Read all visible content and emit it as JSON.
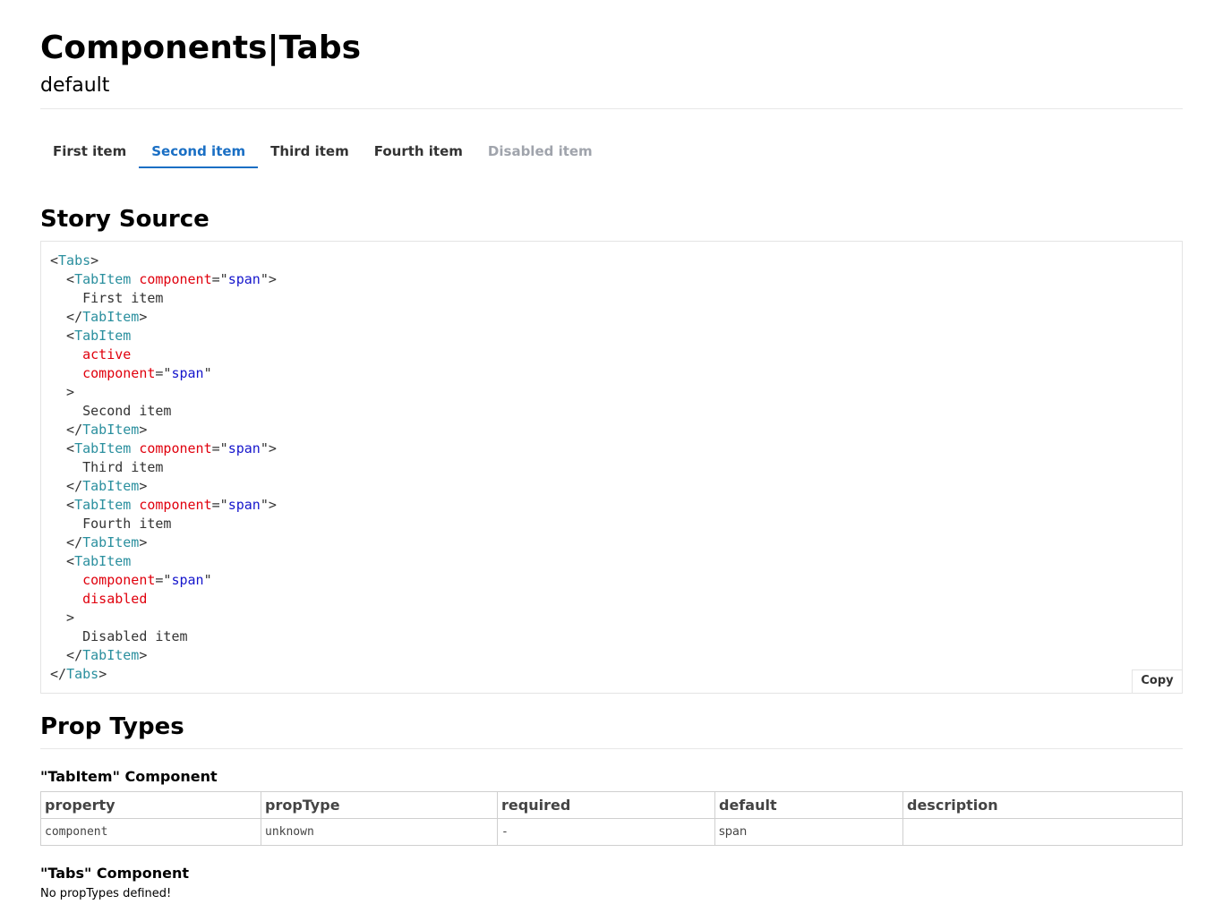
{
  "header": {
    "title": "Components|Tabs",
    "subtitle": "default"
  },
  "tabs": [
    {
      "label": "First item",
      "state": "normal"
    },
    {
      "label": "Second item",
      "state": "active"
    },
    {
      "label": "Third item",
      "state": "normal"
    },
    {
      "label": "Fourth item",
      "state": "normal"
    },
    {
      "label": "Disabled item",
      "state": "disabled"
    }
  ],
  "story_source": {
    "heading": "Story Source",
    "copy_label": "Copy",
    "lines": [
      [
        [
          "p",
          "<"
        ],
        [
          "t",
          "Tabs"
        ],
        [
          "p",
          ">"
        ]
      ],
      [
        [
          "p",
          "  <"
        ],
        [
          "t",
          "TabItem"
        ],
        [
          "p",
          " "
        ],
        [
          "a",
          "component"
        ],
        [
          "p",
          "=\""
        ],
        [
          "v",
          "span"
        ],
        [
          "p",
          "\">"
        ]
      ],
      [
        [
          "p",
          "    First item"
        ]
      ],
      [
        [
          "p",
          "  </"
        ],
        [
          "t",
          "TabItem"
        ],
        [
          "p",
          ">"
        ]
      ],
      [
        [
          "p",
          "  <"
        ],
        [
          "t",
          "TabItem"
        ]
      ],
      [
        [
          "p",
          "    "
        ],
        [
          "a",
          "active"
        ]
      ],
      [
        [
          "p",
          "    "
        ],
        [
          "a",
          "component"
        ],
        [
          "p",
          "=\""
        ],
        [
          "v",
          "span"
        ],
        [
          "p",
          "\""
        ]
      ],
      [
        [
          "p",
          "  >"
        ]
      ],
      [
        [
          "p",
          "    Second item"
        ]
      ],
      [
        [
          "p",
          "  </"
        ],
        [
          "t",
          "TabItem"
        ],
        [
          "p",
          ">"
        ]
      ],
      [
        [
          "p",
          "  <"
        ],
        [
          "t",
          "TabItem"
        ],
        [
          "p",
          " "
        ],
        [
          "a",
          "component"
        ],
        [
          "p",
          "=\""
        ],
        [
          "v",
          "span"
        ],
        [
          "p",
          "\">"
        ]
      ],
      [
        [
          "p",
          "    Third item"
        ]
      ],
      [
        [
          "p",
          "  </"
        ],
        [
          "t",
          "TabItem"
        ],
        [
          "p",
          ">"
        ]
      ],
      [
        [
          "p",
          "  <"
        ],
        [
          "t",
          "TabItem"
        ],
        [
          "p",
          " "
        ],
        [
          "a",
          "component"
        ],
        [
          "p",
          "=\""
        ],
        [
          "v",
          "span"
        ],
        [
          "p",
          "\">"
        ]
      ],
      [
        [
          "p",
          "    Fourth item"
        ]
      ],
      [
        [
          "p",
          "  </"
        ],
        [
          "t",
          "TabItem"
        ],
        [
          "p",
          ">"
        ]
      ],
      [
        [
          "p",
          "  <"
        ],
        [
          "t",
          "TabItem"
        ]
      ],
      [
        [
          "p",
          "    "
        ],
        [
          "a",
          "component"
        ],
        [
          "p",
          "=\""
        ],
        [
          "v",
          "span"
        ],
        [
          "p",
          "\""
        ]
      ],
      [
        [
          "p",
          "    "
        ],
        [
          "a",
          "disabled"
        ]
      ],
      [
        [
          "p",
          "  >"
        ]
      ],
      [
        [
          "p",
          "    Disabled item"
        ]
      ],
      [
        [
          "p",
          "  </"
        ],
        [
          "t",
          "TabItem"
        ],
        [
          "p",
          ">"
        ]
      ],
      [
        [
          "p",
          "</"
        ],
        [
          "t",
          "Tabs"
        ],
        [
          "p",
          ">"
        ]
      ]
    ]
  },
  "prop_types": {
    "heading": "Prop Types",
    "tabitem": {
      "title": "\"TabItem\" Component",
      "columns": [
        "property",
        "propType",
        "required",
        "default",
        "description"
      ],
      "rows": [
        {
          "property": "component",
          "propType": "unknown",
          "required": "-",
          "default": "span",
          "description": ""
        }
      ]
    },
    "tabs": {
      "title": "\"Tabs\" Component",
      "empty_text": "No propTypes defined!"
    }
  },
  "colors": {
    "accent": "#1a6fc4",
    "tag": "#2a8f9e",
    "attr": "#e0000d",
    "value": "#1515cc",
    "disabled": "#a0a4ac"
  }
}
